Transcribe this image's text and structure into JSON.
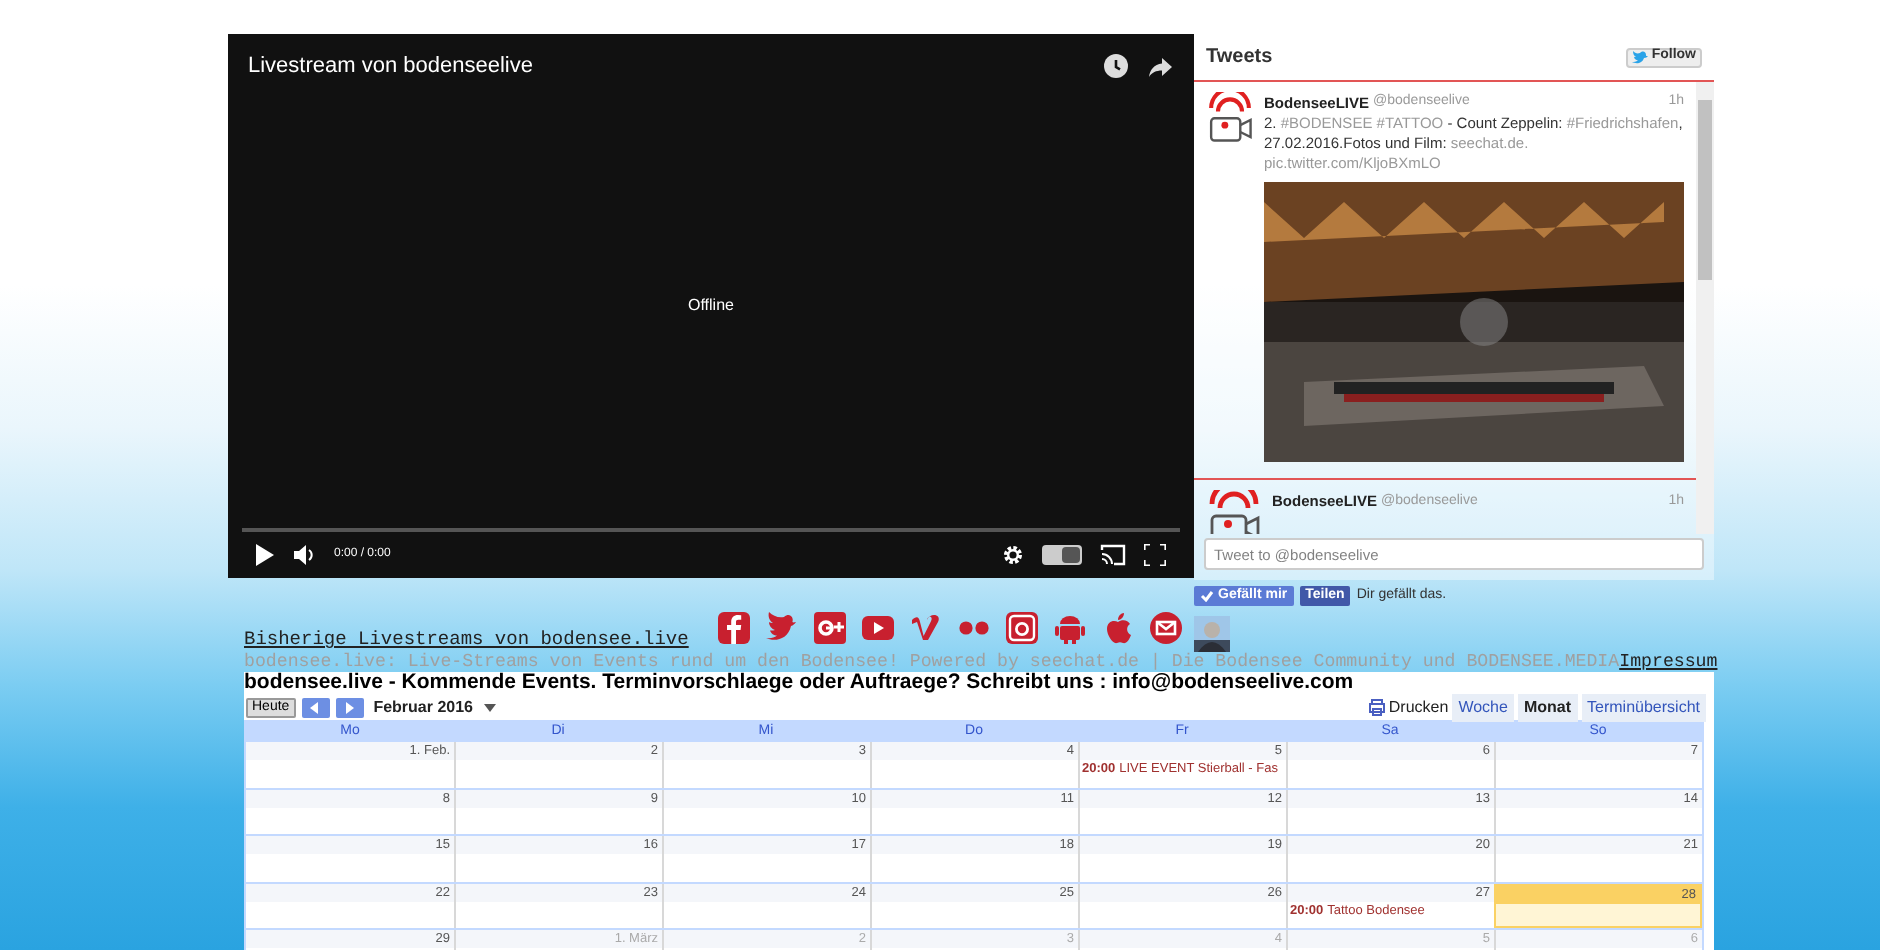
{
  "video": {
    "title": "Livestream von bodenseelive",
    "status": "Offline",
    "time": "0:00 / 0:00"
  },
  "tweets": {
    "title": "Tweets",
    "follow": "Follow",
    "items": [
      {
        "name": "BodenseeLIVE",
        "handle": "@bodenseelive",
        "age": "1h",
        "has_photo": true,
        "text": [
          {
            "kind": "plain",
            "text": "2. "
          },
          {
            "kind": "hashtag",
            "text": "#BODENSEE #TATTOO"
          },
          {
            "kind": "plain",
            "text": " - Count Zeppelin: "
          },
          {
            "kind": "hashtag",
            "text": "#Friedrichshafen"
          },
          {
            "kind": "plain",
            "text": ", 27.02.2016.Fotos und Film: "
          },
          {
            "kind": "link",
            "text": "seechat.de. pic.twitter.com/KljoBXmLO"
          }
        ]
      },
      {
        "name": "BodenseeLIVE",
        "handle": "@bodenseelive",
        "age": "1h",
        "has_photo": false
      }
    ],
    "compose_placeholder": "Tweet to @bodenseelive"
  },
  "like_bar": {
    "like": "Gefällt mir",
    "share": "Teilen",
    "note": "Dir gefällt das."
  },
  "archive_link": "Bisherige Livestreams von bodensee.live",
  "tagline": "bodensee.live: Live-Streams von Events rund um den Bodensee! Powered by seechat.de | Die Bodensee Community und BODENSEE.MEDIA",
  "imprint_link": "Impressum",
  "calendar": {
    "title": "bodensee.live - Kommende Events. Terminvorschlaege oder Auftraege? Schreibt uns : info@bodenseelive.com",
    "today_button": "Heute",
    "month": "Februar 2016",
    "print": "Drucken",
    "views": [
      {
        "label": "Woche",
        "selected": false
      },
      {
        "label": "Monat",
        "selected": true
      },
      {
        "label": "Terminübersicht",
        "selected": false
      }
    ],
    "weekdays": [
      "Mo",
      "Di",
      "Mi",
      "Do",
      "Fr",
      "Sa",
      "So"
    ],
    "weeks": [
      [
        {
          "label": "1. Feb.",
          "other_month": false,
          "today": false
        },
        {
          "label": "2",
          "other_month": false,
          "today": false
        },
        {
          "label": "3",
          "other_month": false,
          "today": false
        },
        {
          "label": "4",
          "other_month": false,
          "today": false
        },
        {
          "label": "5",
          "other_month": false,
          "today": false,
          "events": [
            {
              "time": "20:00",
              "title": "LIVE EVENT Stierball - Fas"
            }
          ]
        },
        {
          "label": "6",
          "other_month": false,
          "today": false
        },
        {
          "label": "7",
          "other_month": false,
          "today": false
        }
      ],
      [
        {
          "label": "8",
          "other_month": false,
          "today": false
        },
        {
          "label": "9",
          "other_month": false,
          "today": false
        },
        {
          "label": "10",
          "other_month": false,
          "today": false
        },
        {
          "label": "11",
          "other_month": false,
          "today": false
        },
        {
          "label": "12",
          "other_month": false,
          "today": false
        },
        {
          "label": "13",
          "other_month": false,
          "today": false
        },
        {
          "label": "14",
          "other_month": false,
          "today": false
        }
      ],
      [
        {
          "label": "15",
          "other_month": false,
          "today": false
        },
        {
          "label": "16",
          "other_month": false,
          "today": false
        },
        {
          "label": "17",
          "other_month": false,
          "today": false
        },
        {
          "label": "18",
          "other_month": false,
          "today": false
        },
        {
          "label": "19",
          "other_month": false,
          "today": false
        },
        {
          "label": "20",
          "other_month": false,
          "today": false
        },
        {
          "label": "21",
          "other_month": false,
          "today": false
        }
      ],
      [
        {
          "label": "22",
          "other_month": false,
          "today": false
        },
        {
          "label": "23",
          "other_month": false,
          "today": false
        },
        {
          "label": "24",
          "other_month": false,
          "today": false
        },
        {
          "label": "25",
          "other_month": false,
          "today": false
        },
        {
          "label": "26",
          "other_month": false,
          "today": false
        },
        {
          "label": "27",
          "other_month": false,
          "today": false,
          "events": [
            {
              "time": "20:00",
              "title": "Tattoo Bodensee"
            }
          ]
        },
        {
          "label": "28",
          "other_month": false,
          "today": true
        }
      ],
      [
        {
          "label": "29",
          "other_month": false,
          "today": false
        },
        {
          "label": "1. März",
          "other_month": true,
          "today": false
        },
        {
          "label": "2",
          "other_month": true,
          "today": false
        },
        {
          "label": "3",
          "other_month": true,
          "today": false
        },
        {
          "label": "4",
          "other_month": true,
          "today": false
        },
        {
          "label": "5",
          "other_month": true,
          "today": false
        },
        {
          "label": "6",
          "other_month": true,
          "today": false
        }
      ]
    ]
  }
}
